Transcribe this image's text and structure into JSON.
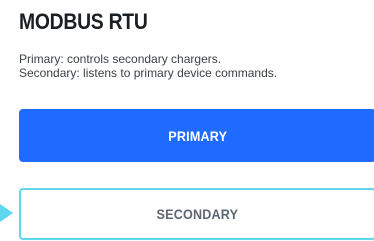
{
  "section": {
    "title": "MODBUS RTU",
    "description_lines": [
      "Primary: controls secondary chargers.",
      "Secondary: listens to primary device commands."
    ]
  },
  "options": {
    "primary_label": "PRIMARY",
    "secondary_label": "SECONDARY"
  },
  "colors": {
    "primary_button": "#1f6bff",
    "highlight_border": "#5ed7ef"
  }
}
